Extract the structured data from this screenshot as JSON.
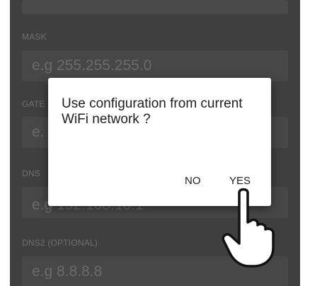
{
  "fields": {
    "mask": {
      "label": "MASK",
      "placeholder": "e.g 255.255.255.0"
    },
    "gateway": {
      "label_partial": "GATE",
      "placeholder_partial": "e."
    },
    "dns": {
      "label": "DNS",
      "placeholder_partial": "e.g 192.168.10.1"
    },
    "dns2": {
      "label": "DNS2 (OPTIONAL)",
      "placeholder": "e.g 8.8.8.8"
    }
  },
  "dialog": {
    "message": "Use configuration from current WiFi network ?",
    "no_label": "NO",
    "yes_label": "YES"
  },
  "overlay": {
    "pointer": "pointing-hand-icon"
  },
  "colors": {
    "dim_background": "#3f3f3f",
    "dialog_background": "#ffffff"
  }
}
